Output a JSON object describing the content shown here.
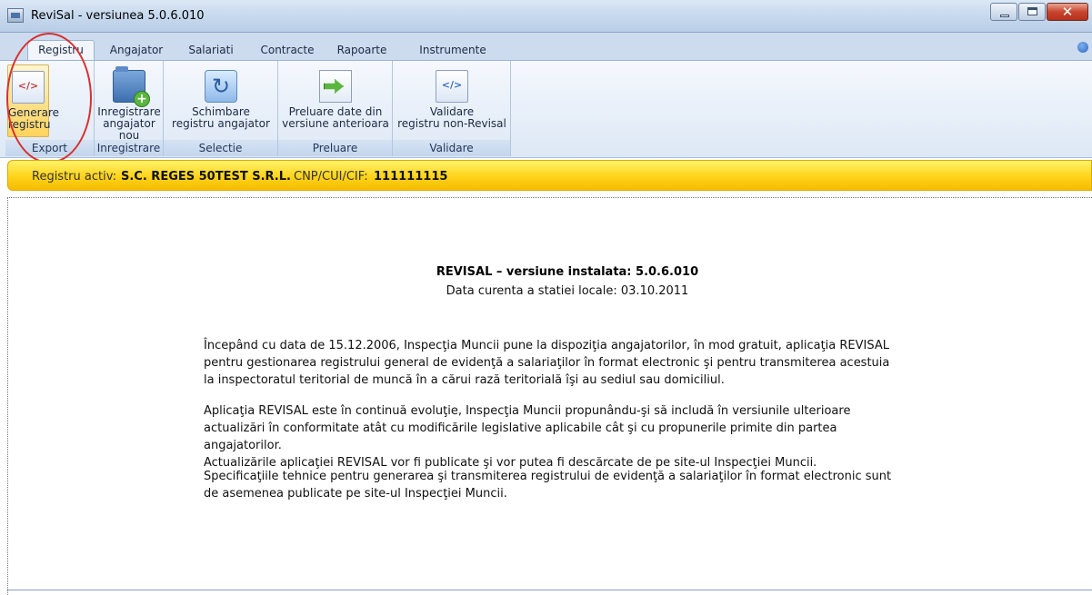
{
  "window": {
    "title": "ReviSal - versiunea 5.0.6.010"
  },
  "tabs": [
    "Registru",
    "Angajator",
    "Salariati",
    "Contracte",
    "Rapoarte",
    "Instrumente"
  ],
  "ribbon": {
    "groups": {
      "export": {
        "label": "Export",
        "btn": [
          "Generare",
          "registru"
        ]
      },
      "inregistrare": {
        "label": "Inregistrare",
        "btn": [
          "Inregistrare",
          "angajator nou"
        ]
      },
      "selectie": {
        "label": "Selectie",
        "btn": [
          "Schimbare",
          "registru angajator"
        ]
      },
      "preluare": {
        "label": "Preluare",
        "btn": [
          "Preluare date din",
          "versiune anterioara"
        ]
      },
      "validare": {
        "label": "Validare",
        "btn": [
          "Validare",
          "registru non-Revisal"
        ]
      }
    }
  },
  "active_register": {
    "label": "Registru activ:",
    "company": "S.C. REGES 50TEST S.R.L.",
    "cui_label": "CNP/CUI/CIF:",
    "cui_value": "111111115"
  },
  "content": {
    "title": "REVISAL – versiune instalata: 5.0.6.010",
    "subtitle": "Data curenta a statiei locale: 03.10.2011",
    "para1": [
      "Începând cu data de 15.12.2006, Inspecţia Muncii pune la dispoziţia angajatorilor, în mod gratuit, aplicaţia REVISAL",
      "pentru gestionarea registrului general de evidenţă a salariaţilor în format electronic şi pentru transmiterea acestuia",
      "la inspectoratul teritorial de muncă în a cărui rază teritorială îşi au sediul sau domiciliul."
    ],
    "para2": [
      "Aplicaţia REVISAL este în continuă evoluţie, Inspecţia Muncii propunându-şi să includă în versiunile ulterioare",
      "actualizări în conformitate atât cu modificările legislative aplicabile cât şi cu propunerile primite din partea angajatorilor.",
      "Actualizările aplicaţiei REVISAL vor fi publicate şi vor putea fi descărcate de pe site-ul Inspecţiei Muncii."
    ],
    "para3": [
      "Specificaţiile tehnice pentru generarea şi transmiterea registrului de evidenţă a salariaţilor în format electronic sunt",
      "de asemenea publicate pe site-ul Inspecţiei Muncii."
    ]
  },
  "colors": {
    "highlight": "#ffd35c",
    "annotation": "#d93030",
    "banner": "#ffd31a"
  },
  "icons": [
    "xml-document-icon",
    "add-folder-icon",
    "refresh-icon",
    "import-icon",
    "validate-document-icon"
  ]
}
